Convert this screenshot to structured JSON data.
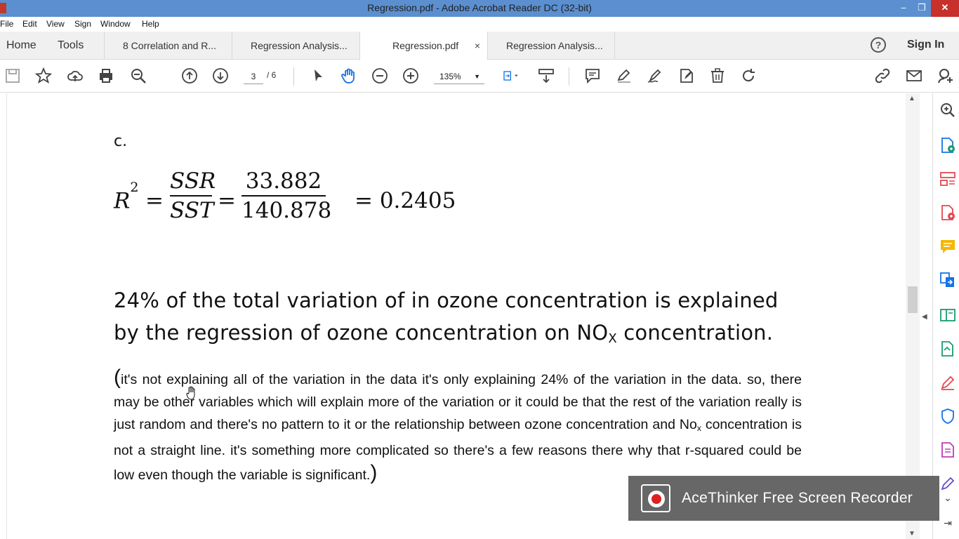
{
  "window": {
    "title": "Regression.pdf - Adobe Acrobat Reader DC (32-bit)",
    "min": "–",
    "max": "❐",
    "close": "✕"
  },
  "menu": [
    "File",
    "Edit",
    "View",
    "Sign",
    "Window",
    "Help"
  ],
  "tabs": {
    "home": "Home",
    "tools": "Tools",
    "docs": [
      "8 Correlation and R...",
      "Regression Analysis...",
      "Regression.pdf",
      "Regression Analysis..."
    ],
    "active_close": "×"
  },
  "header": {
    "help": "?",
    "sign_in": "Sign In"
  },
  "toolbar": {
    "page_current": "3",
    "page_total": "/ 6",
    "zoom": "135%"
  },
  "document": {
    "section_label": "c.",
    "formula": {
      "lhs": "R",
      "lhs_sup": "2",
      "eq": "=",
      "num1": "SSR",
      "den1": "SST",
      "num2": "33.882",
      "den2": "140.878",
      "result": "= 0.2405"
    },
    "para1": {
      "text_a": "24% of the total variation of in ozone concentration is explained by the regression of ozone concentration on NO",
      "sub": "X",
      "text_b": " concentration."
    },
    "para2": {
      "open": "(",
      "text_a": "it's not explaining all of the variation in the data it's only explaining 24% of the variation in the data. so, there may be other variables which will explain more of the variation or it could be that the rest of the variation really is just random and there's no pattern to it or the relationship between ozone concentration and No",
      "sub": "x",
      "text_b": " concentration is not a straight line. it's something more complicated so there's a few reasons there why that r-squared could be low even though the variable is significant.",
      "close": ")"
    }
  },
  "overlay": {
    "recorder_label": "AceThinker Free Screen Recorder"
  },
  "colors": {
    "titlebar": "#5b8fd0",
    "close_button": "#c7302b",
    "accent_blue": "#1473e6"
  }
}
